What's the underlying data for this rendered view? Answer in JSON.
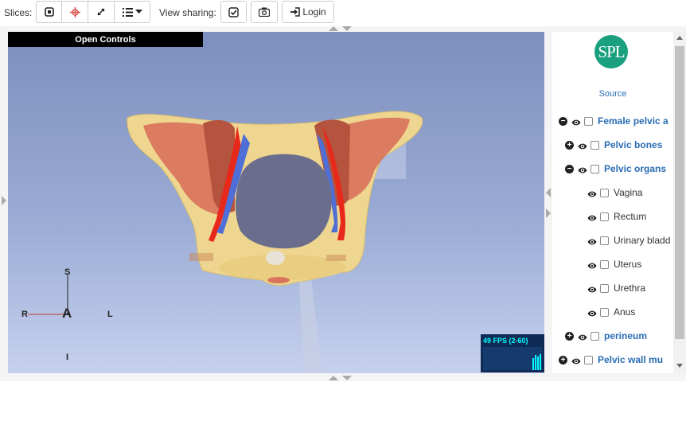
{
  "toolbar": {
    "slices_label": "Slices:",
    "view_sharing_label": "View sharing:",
    "login_label": "Login"
  },
  "viewer": {
    "open_controls": "Open Controls",
    "axes": {
      "superior": "S",
      "inferior": "I",
      "right": "R",
      "left": "L",
      "anterior": "A"
    },
    "fps": "49 FPS (2-60)"
  },
  "panel": {
    "logo_text": "SPL",
    "source_link": "Source",
    "tree": [
      {
        "label": "Female pelvic a",
        "bold": true,
        "toggle": "minus",
        "level": 0
      },
      {
        "label": "Pelvic bones",
        "bold": true,
        "toggle": "plus",
        "level": 1
      },
      {
        "label": "Pelvic organs",
        "bold": true,
        "toggle": "minus",
        "level": 1
      },
      {
        "label": "Vagina",
        "bold": false,
        "toggle": "none",
        "level": 2
      },
      {
        "label": "Rectum",
        "bold": false,
        "toggle": "none",
        "level": 2
      },
      {
        "label": "Urinary bladd",
        "bold": false,
        "toggle": "none",
        "level": 2
      },
      {
        "label": "Uterus",
        "bold": false,
        "toggle": "none",
        "level": 2
      },
      {
        "label": "Urethra",
        "bold": false,
        "toggle": "none",
        "level": 2
      },
      {
        "label": "Anus",
        "bold": false,
        "toggle": "none",
        "level": 2
      },
      {
        "label": "perineum",
        "bold": true,
        "toggle": "plus",
        "level": 1
      },
      {
        "label": "Pelvic wall mu",
        "bold": true,
        "toggle": "plus",
        "level": 0
      }
    ]
  },
  "colors": {
    "bone": "#efd690",
    "muscle": "#d9735c",
    "artery": "#e8281a",
    "vein": "#4f6fd6",
    "bladder": "#6b6d8c",
    "link": "#2a6db5",
    "logo": "#1aa07e"
  }
}
